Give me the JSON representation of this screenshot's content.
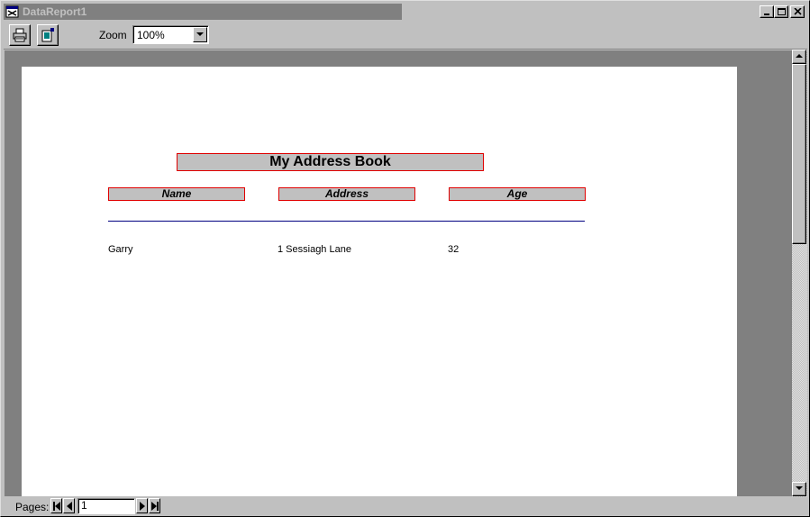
{
  "window": {
    "title": "DataReport1",
    "controls": {
      "minimize": "minimize-icon",
      "maximize": "maximize-icon",
      "close": "close-icon"
    }
  },
  "toolbar": {
    "print_icon": "printer-icon",
    "export_icon": "export-icon",
    "zoom_label": "Zoom",
    "zoom_value": "100%"
  },
  "report": {
    "title": "My Address Book",
    "headers": [
      "Name",
      "Address",
      "Age"
    ],
    "rows": [
      [
        "Garry",
        "1 Sessiagh Lane",
        "32"
      ]
    ],
    "colors": {
      "header_border": "#e00000",
      "header_fill": "#c0c0c0",
      "rule": "#000080"
    }
  },
  "pager": {
    "label": "Pages:",
    "current_page": "1"
  }
}
